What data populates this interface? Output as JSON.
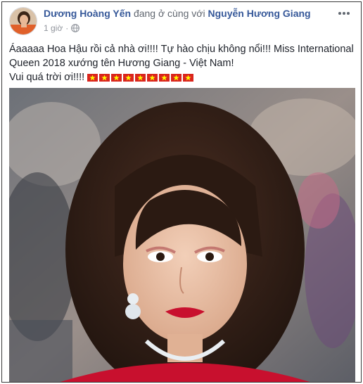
{
  "post": {
    "author": "Dương Hoàng Yến",
    "with_text": "đang ở cùng với",
    "tagged": "Nguyễn Hương Giang",
    "time": "1 giờ",
    "dot": "·",
    "privacy_icon": "globe-icon",
    "more_icon": "more-options-icon",
    "text_line1": "Áaaaaa Hoa Hậu rồi cả nhà ơi!!!! Tự hào chịu không nổi!!! Miss International",
    "text_line2": "Queen 2018 xướng tên Hương Giang - Việt Nam!",
    "text_line3": "Vui quá trời ơi!!!!",
    "flag_emoji_count": 9,
    "flag_colors": {
      "red": "#da251d",
      "star": "#ffff00"
    }
  },
  "colors": {
    "link": "#365899",
    "meta": "#90949c",
    "text": "#1d2129"
  }
}
